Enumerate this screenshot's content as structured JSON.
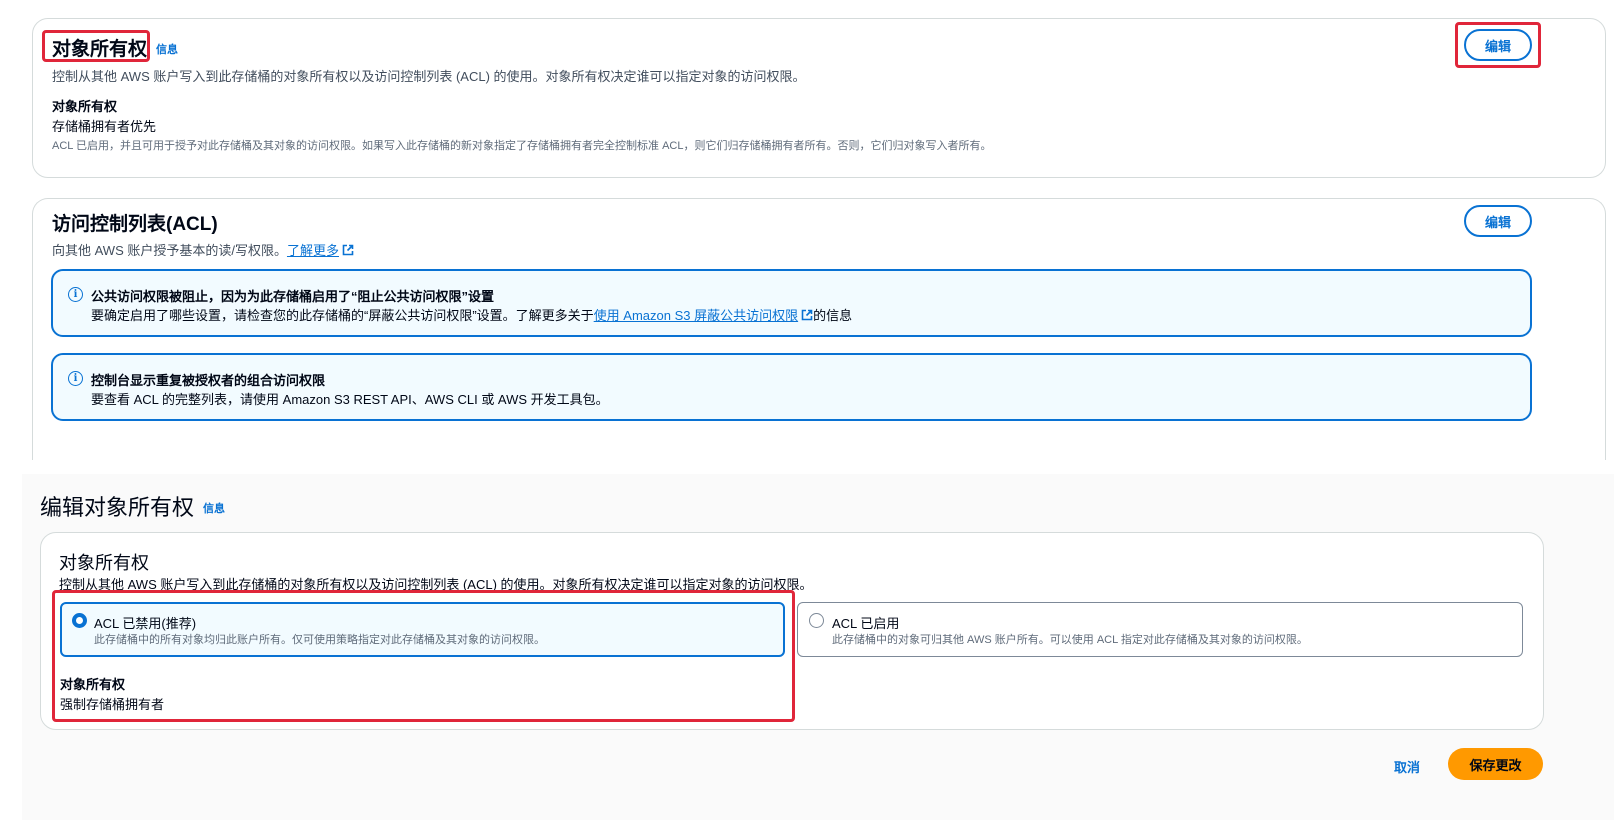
{
  "object_ownership": {
    "title": "对象所有权",
    "info": "信息",
    "description": "控制从其他 AWS 账户写入到此存储桶的对象所有权以及访问控制列表 (ACL) 的使用。对象所有权决定谁可以指定对象的访问权限。",
    "field_label": "对象所有权",
    "field_value": "存储桶拥有者优先",
    "note": "ACL 已启用，并且可用于授予对此存储桶及其对象的访问权限。如果写入此存储桶的新对象指定了存储桶拥有者完全控制标准 ACL，则它们归存储桶拥有者所有。否则，它们归对象写入者所有。",
    "edit_label": "编辑"
  },
  "acl": {
    "title": "访问控制列表(ACL)",
    "description": "向其他 AWS 账户授予基本的读/写权限。",
    "learn_more": "了解更多",
    "edit_label": "编辑",
    "alert1": {
      "title": "公共访问权限被阻止，因为为此存储桶启用了“阻止公共访问权限”设置",
      "text_prefix": "要确定启用了哪些设置，请检查您的此存储桶的“屏蔽公共访问权限”设置。了解更多关于",
      "link": "使用 Amazon S3 屏蔽公共访问权限",
      "text_suffix": "的信息"
    },
    "alert2": {
      "title": "控制台显示重复被授权者的组合访问权限",
      "text": "要查看 ACL 的完整列表，请使用 Amazon S3 REST API、AWS CLI 或 AWS 开发工具包。"
    }
  },
  "edit_page": {
    "title": "编辑对象所有权",
    "info": "信息",
    "section_title": "对象所有权",
    "section_description": "控制从其他 AWS 账户写入到此存储桶的对象所有权以及访问控制列表 (ACL) 的使用。对象所有权决定谁可以指定对象的访问权限。",
    "options": [
      {
        "label": "ACL 已禁用(推荐)",
        "description": "此存储桶中的所有对象均归此账户所有。仅可使用策略指定对此存储桶及其对象的访问权限。",
        "selected": true
      },
      {
        "label": "ACL 已启用",
        "description": "此存储桶中的对象可归其他 AWS 账户所有。可以使用 ACL 指定对此存储桶及其对象的访问权限。",
        "selected": false
      }
    ],
    "result_label": "对象所有权",
    "result_value": "强制存储桶拥有者",
    "cancel_label": "取消",
    "save_label": "保存更改"
  },
  "colors": {
    "link": "#0972d3",
    "highlight": "#e0263a",
    "primary": "#ff9900",
    "alert_bg": "#f2fbff"
  }
}
